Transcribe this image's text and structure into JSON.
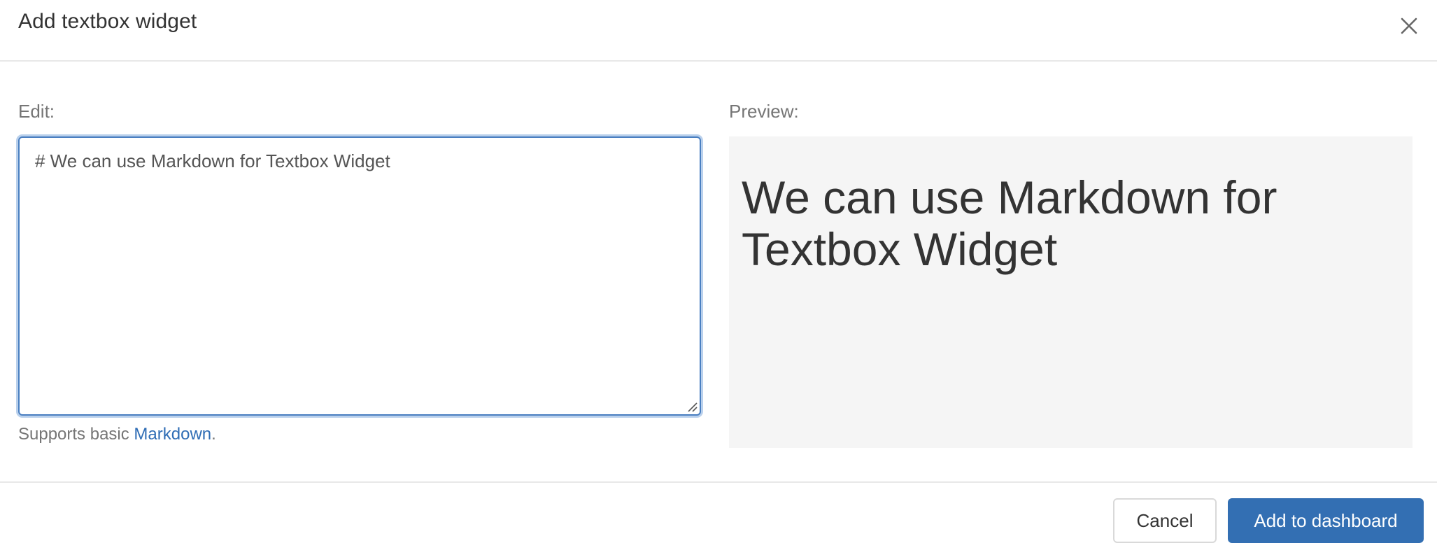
{
  "dialog": {
    "title": "Add textbox widget",
    "close_icon": "close-icon"
  },
  "editor": {
    "label": "Edit:",
    "value": "# We can use Markdown for Textbox Widget",
    "help_prefix": "Supports basic ",
    "help_link": "Markdown",
    "help_suffix": "."
  },
  "preview": {
    "label": "Preview:",
    "heading": "We can use Markdown for Textbox Widget"
  },
  "footer": {
    "cancel_label": "Cancel",
    "submit_label": "Add to dashboard"
  },
  "colors": {
    "primary": "#336fb3",
    "link": "#2f6db5",
    "focus_border": "#4a7fc1",
    "preview_bg": "#f5f5f5"
  }
}
